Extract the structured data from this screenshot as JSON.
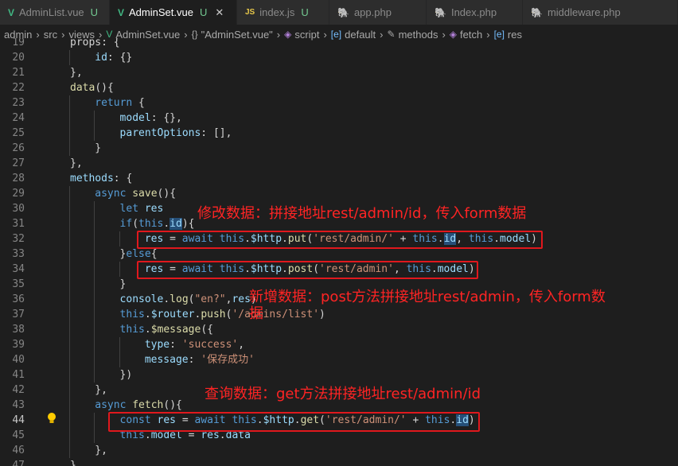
{
  "tabs": [
    {
      "icon": "V",
      "name": "AdminList.vue",
      "status": "U",
      "type": "vue",
      "active": false
    },
    {
      "icon": "V",
      "name": "AdminSet.vue",
      "status": "U",
      "type": "vue",
      "active": true
    },
    {
      "icon": "JS",
      "name": "index.js",
      "status": "U",
      "type": "js",
      "active": false
    },
    {
      "icon": "🐘",
      "name": "app.php",
      "status": "",
      "type": "php",
      "active": false
    },
    {
      "icon": "🐘",
      "name": "Index.php",
      "status": "",
      "type": "php",
      "active": false
    },
    {
      "icon": "🐘",
      "name": "middleware.php",
      "status": "",
      "type": "php",
      "active": false
    }
  ],
  "breadcrumb": [
    {
      "label": "admin"
    },
    {
      "label": "src"
    },
    {
      "label": "views"
    },
    {
      "icon": "V",
      "label": "AdminSet.vue"
    },
    {
      "icon": "{}",
      "label": "\"AdminSet.vue\""
    },
    {
      "icon": "◈",
      "label": "script"
    },
    {
      "icon": "[e]",
      "label": "default"
    },
    {
      "icon": "✎",
      "label": "methods"
    },
    {
      "icon": "◈",
      "label": "fetch"
    },
    {
      "icon": "[e]",
      "label": "res"
    }
  ],
  "editor": {
    "current_line": 44,
    "lines": [
      {
        "n": 19,
        "i": 1,
        "t": [
          [
            "p",
            "props: {"
          ]
        ]
      },
      {
        "n": 20,
        "i": 2,
        "t": [
          [
            "v",
            "id"
          ],
          [
            "p",
            ": {}"
          ]
        ]
      },
      {
        "n": 21,
        "i": 1,
        "t": [
          [
            "p",
            "},"
          ]
        ]
      },
      {
        "n": 22,
        "i": 1,
        "t": [
          [
            "f",
            "data"
          ],
          [
            "p",
            "(){"
          ]
        ]
      },
      {
        "n": 23,
        "i": 2,
        "t": [
          [
            "k",
            "return"
          ],
          [
            "p",
            " {"
          ]
        ]
      },
      {
        "n": 24,
        "i": 3,
        "t": [
          [
            "v",
            "model"
          ],
          [
            "p",
            ": {},"
          ]
        ]
      },
      {
        "n": 25,
        "i": 3,
        "t": [
          [
            "v",
            "parentOptions"
          ],
          [
            "p",
            ": [],"
          ]
        ]
      },
      {
        "n": 26,
        "i": 2,
        "t": [
          [
            "p",
            "}"
          ]
        ]
      },
      {
        "n": 27,
        "i": 1,
        "t": [
          [
            "p",
            "},"
          ]
        ]
      },
      {
        "n": 28,
        "i": 1,
        "t": [
          [
            "v",
            "methods"
          ],
          [
            "p",
            ": {"
          ]
        ]
      },
      {
        "n": 29,
        "i": 2,
        "t": [
          [
            "k",
            "async"
          ],
          [
            "p",
            " "
          ],
          [
            "f",
            "save"
          ],
          [
            "p",
            "(){"
          ]
        ]
      },
      {
        "n": 30,
        "i": 3,
        "t": [
          [
            "k",
            "let"
          ],
          [
            "p",
            " "
          ],
          [
            "v",
            "res"
          ]
        ]
      },
      {
        "n": 31,
        "i": 3,
        "t": [
          [
            "k",
            "if"
          ],
          [
            "p",
            "("
          ],
          [
            "k",
            "this"
          ],
          [
            "p",
            "."
          ],
          [
            "vh",
            "id"
          ],
          [
            "p",
            "){"
          ]
        ]
      },
      {
        "n": 32,
        "i": 4,
        "t": [
          [
            "v",
            "res"
          ],
          [
            "p",
            " = "
          ],
          [
            "k",
            "await"
          ],
          [
            "p",
            " "
          ],
          [
            "k",
            "this"
          ],
          [
            "p",
            "."
          ],
          [
            "v",
            "$http"
          ],
          [
            "p",
            "."
          ],
          [
            "f",
            "put"
          ],
          [
            "p",
            "("
          ],
          [
            "s",
            "'rest/admin/'"
          ],
          [
            "p",
            " + "
          ],
          [
            "k",
            "this"
          ],
          [
            "p",
            "."
          ],
          [
            "vh",
            "id"
          ],
          [
            "p",
            ", "
          ],
          [
            "k",
            "this"
          ],
          [
            "p",
            "."
          ],
          [
            "v",
            "model"
          ],
          [
            "p",
            ")"
          ]
        ]
      },
      {
        "n": 33,
        "i": 3,
        "t": [
          [
            "p",
            "}"
          ],
          [
            "k",
            "else"
          ],
          [
            "p",
            "{"
          ]
        ]
      },
      {
        "n": 34,
        "i": 4,
        "t": [
          [
            "v",
            "res"
          ],
          [
            "p",
            " = "
          ],
          [
            "k",
            "await"
          ],
          [
            "p",
            " "
          ],
          [
            "k",
            "this"
          ],
          [
            "p",
            "."
          ],
          [
            "v",
            "$http"
          ],
          [
            "p",
            "."
          ],
          [
            "f",
            "post"
          ],
          [
            "p",
            "("
          ],
          [
            "s",
            "'rest/admin'"
          ],
          [
            "p",
            ", "
          ],
          [
            "k",
            "this"
          ],
          [
            "p",
            "."
          ],
          [
            "v",
            "model"
          ],
          [
            "p",
            ")"
          ]
        ]
      },
      {
        "n": 35,
        "i": 3,
        "t": [
          [
            "p",
            "}"
          ]
        ]
      },
      {
        "n": 36,
        "i": 3,
        "t": [
          [
            "v",
            "console"
          ],
          [
            "p",
            "."
          ],
          [
            "f",
            "log"
          ],
          [
            "p",
            "("
          ],
          [
            "s",
            "\"en?\""
          ],
          [
            "p",
            ","
          ],
          [
            "v",
            "res"
          ],
          [
            "p",
            ")"
          ]
        ]
      },
      {
        "n": 37,
        "i": 3,
        "t": [
          [
            "k",
            "this"
          ],
          [
            "p",
            "."
          ],
          [
            "v",
            "$router"
          ],
          [
            "p",
            "."
          ],
          [
            "f",
            "push"
          ],
          [
            "p",
            "("
          ],
          [
            "s",
            "'/admins/list'"
          ],
          [
            "p",
            ")"
          ]
        ]
      },
      {
        "n": 38,
        "i": 3,
        "t": [
          [
            "k",
            "this"
          ],
          [
            "p",
            "."
          ],
          [
            "f",
            "$message"
          ],
          [
            "p",
            "({"
          ]
        ]
      },
      {
        "n": 39,
        "i": 4,
        "t": [
          [
            "v",
            "type"
          ],
          [
            "p",
            ": "
          ],
          [
            "s",
            "'success'"
          ],
          [
            "p",
            ","
          ]
        ]
      },
      {
        "n": 40,
        "i": 4,
        "t": [
          [
            "v",
            "message"
          ],
          [
            "p",
            ": "
          ],
          [
            "s",
            "'保存成功'"
          ]
        ]
      },
      {
        "n": 41,
        "i": 3,
        "t": [
          [
            "p",
            "})"
          ]
        ]
      },
      {
        "n": 42,
        "i": 2,
        "t": [
          [
            "p",
            "},"
          ]
        ]
      },
      {
        "n": 43,
        "i": 2,
        "t": [
          [
            "k",
            "async"
          ],
          [
            "p",
            " "
          ],
          [
            "f",
            "fetch"
          ],
          [
            "p",
            "(){"
          ]
        ]
      },
      {
        "n": 44,
        "i": 3,
        "t": [
          [
            "k",
            "const"
          ],
          [
            "p",
            " "
          ],
          [
            "v",
            "res"
          ],
          [
            "p",
            " = "
          ],
          [
            "k",
            "await"
          ],
          [
            "p",
            " "
          ],
          [
            "k",
            "this"
          ],
          [
            "p",
            "."
          ],
          [
            "v",
            "$http"
          ],
          [
            "p",
            "."
          ],
          [
            "f",
            "get"
          ],
          [
            "p",
            "("
          ],
          [
            "s",
            "'rest/admin/'"
          ],
          [
            "p",
            " + "
          ],
          [
            "k",
            "this"
          ],
          [
            "p",
            "."
          ],
          [
            "vh",
            "id"
          ],
          [
            "p",
            ")"
          ]
        ]
      },
      {
        "n": 45,
        "i": 3,
        "t": [
          [
            "k",
            "this"
          ],
          [
            "p",
            "."
          ],
          [
            "v",
            "model"
          ],
          [
            "p",
            " = "
          ],
          [
            "v",
            "res"
          ],
          [
            "p",
            "."
          ],
          [
            "v",
            "data"
          ]
        ]
      },
      {
        "n": 46,
        "i": 2,
        "t": [
          [
            "p",
            "},"
          ]
        ]
      },
      {
        "n": 47,
        "i": 1,
        "t": [
          [
            "p",
            "}"
          ]
        ]
      }
    ]
  },
  "annotations": {
    "update": "修改数据：拼接地址rest/admin/id，传入form数据",
    "create_line1": "新增数据：post方法拼接地址rest/admin，传入form数",
    "create_line2": "据",
    "query": "查询数据：get方法拼接地址rest/admin/id"
  },
  "colors": {
    "annotation": "#ff2424",
    "box": "#e0181d",
    "keyword": "#569cd6",
    "function": "#dcdcaa",
    "variable": "#9cdcfe",
    "string": "#ce9178"
  },
  "icons": {
    "hint": "lightbulb-icon"
  }
}
